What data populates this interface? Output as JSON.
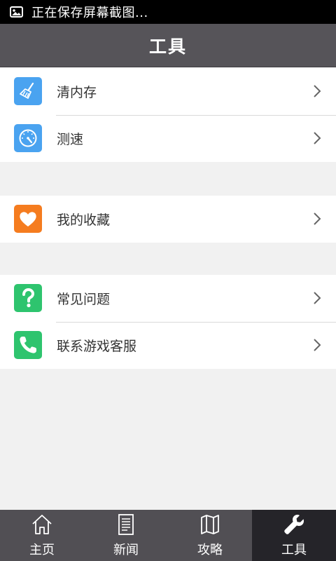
{
  "status_bar": {
    "text": "正在保存屏幕截图...",
    "icon": "image-icon"
  },
  "header": {
    "title": "工具"
  },
  "groups": [
    {
      "items": [
        {
          "label": "清内存",
          "icon": "broom-icon",
          "color": "#4aa3f0"
        },
        {
          "label": "测速",
          "icon": "speedometer-icon",
          "color": "#4aa3f0"
        }
      ]
    },
    {
      "items": [
        {
          "label": "我的收藏",
          "icon": "heart-icon",
          "color": "#f57c1f"
        }
      ]
    },
    {
      "items": [
        {
          "label": "常见问题",
          "icon": "question-icon",
          "color": "#2ec46e"
        },
        {
          "label": "联系游戏客服",
          "icon": "phone-icon",
          "color": "#2ec46e"
        }
      ]
    }
  ],
  "tabs": [
    {
      "label": "主页",
      "icon": "home-icon",
      "active": false
    },
    {
      "label": "新闻",
      "icon": "news-icon",
      "active": false
    },
    {
      "label": "攻略",
      "icon": "map-icon",
      "active": false
    },
    {
      "label": "工具",
      "icon": "wrench-icon",
      "active": true
    }
  ]
}
